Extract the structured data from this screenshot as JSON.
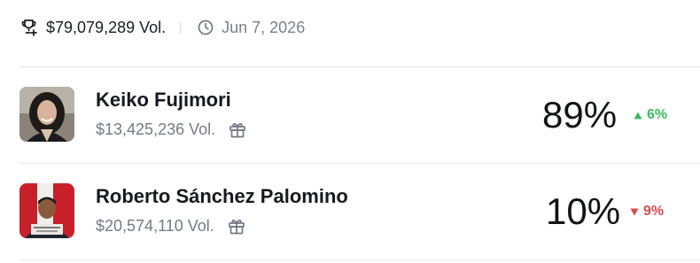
{
  "header": {
    "volume": "$79,079,289 Vol.",
    "date": "Jun 7, 2026",
    "trophy_icon": "trophy-icon",
    "clock_icon": "clock-icon"
  },
  "outcomes": [
    {
      "name": "Keiko Fujimori",
      "volume": "$13,425,236 Vol.",
      "percent": "89%",
      "change": "6%",
      "direction": "up",
      "change_color": "#3dbb64"
    },
    {
      "name": "Roberto Sánchez Palomino",
      "volume": "$20,574,110 Vol.",
      "percent": "10%",
      "change": "9%",
      "direction": "down",
      "change_color": "#e0474c"
    }
  ],
  "icons": {
    "gift": "gift-icon",
    "up": "triangle-up-icon",
    "down": "triangle-down-icon"
  }
}
